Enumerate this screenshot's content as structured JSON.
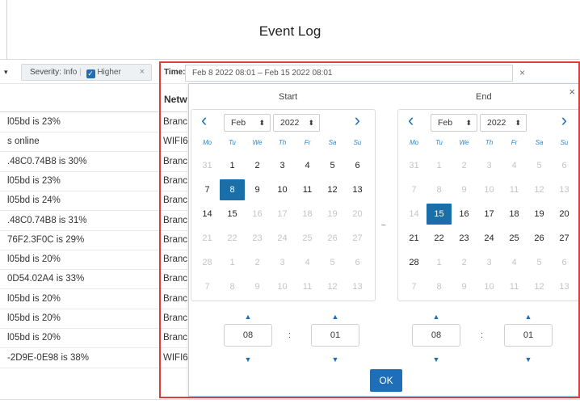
{
  "window": {
    "title": "Event Log"
  },
  "filters": {
    "severity": {
      "label": "Severity:",
      "value": "Info",
      "higher_label": "Higher",
      "close": "×"
    }
  },
  "table": {
    "network_header": "Netw",
    "rows": [
      {
        "desc": "l05bd is 23%",
        "net": "Branc"
      },
      {
        "desc": "s online",
        "net": "WIFI6"
      },
      {
        "desc": ".48C0.74B8 is 30%",
        "net": "Branc"
      },
      {
        "desc": "l05bd is 23%",
        "net": "Branc"
      },
      {
        "desc": "l05bd is 24%",
        "net": "Branc"
      },
      {
        "desc": ".48C0.74B8 is 31%",
        "net": "Branc"
      },
      {
        "desc": "76F2.3F0C is 29%",
        "net": "Branc"
      },
      {
        "desc": "l05bd is 20%",
        "net": "Branc"
      },
      {
        "desc": "0D54.02A4 is 33%",
        "net": "Branc"
      },
      {
        "desc": "l05bd is 20%",
        "net": "Branc"
      },
      {
        "desc": "l05bd is 20%",
        "net": "Branc"
      },
      {
        "desc": "l05bd is 20%",
        "net": "Branc"
      },
      {
        "desc": "-2D9E-0E98 is 38%",
        "net": "WIFI6"
      }
    ]
  },
  "time_filter": {
    "label": "Time:",
    "value": "Feb 8 2022 08:01 – Feb 15 2022 08:01",
    "close": "×"
  },
  "picker": {
    "close": "×",
    "range_separator": "~",
    "ok_label": "OK",
    "weekdays": [
      "Mo",
      "Tu",
      "We",
      "Th",
      "Fr",
      "Sa",
      "Su"
    ],
    "start": {
      "title": "Start",
      "month": "Feb",
      "year": "2022",
      "hour": "08",
      "minute": "01",
      "selected_day": "8",
      "weeks": [
        [
          "31",
          "1",
          "2",
          "3",
          "4",
          "5",
          "6"
        ],
        [
          "7",
          "8",
          "9",
          "10",
          "11",
          "12",
          "13"
        ],
        [
          "14",
          "15",
          "16",
          "17",
          "18",
          "19",
          "20"
        ],
        [
          "21",
          "22",
          "23",
          "24",
          "25",
          "26",
          "27"
        ],
        [
          "28",
          "1",
          "2",
          "3",
          "4",
          "5",
          "6"
        ],
        [
          "7",
          "8",
          "9",
          "10",
          "11",
          "12",
          "13"
        ]
      ],
      "muted": [
        [
          true,
          false,
          false,
          false,
          false,
          false,
          false
        ],
        [
          false,
          false,
          false,
          false,
          false,
          false,
          false
        ],
        [
          false,
          false,
          true,
          true,
          true,
          true,
          true
        ],
        [
          true,
          true,
          true,
          true,
          true,
          true,
          true
        ],
        [
          true,
          true,
          true,
          true,
          true,
          true,
          true
        ],
        [
          true,
          true,
          true,
          true,
          true,
          true,
          true
        ]
      ]
    },
    "end": {
      "title": "End",
      "month": "Feb",
      "year": "2022",
      "hour": "08",
      "minute": "01",
      "selected_day": "15",
      "weeks": [
        [
          "31",
          "1",
          "2",
          "3",
          "4",
          "5",
          "6"
        ],
        [
          "7",
          "8",
          "9",
          "10",
          "11",
          "12",
          "13"
        ],
        [
          "14",
          "15",
          "16",
          "17",
          "18",
          "19",
          "20"
        ],
        [
          "21",
          "22",
          "23",
          "24",
          "25",
          "26",
          "27"
        ],
        [
          "28",
          "1",
          "2",
          "3",
          "4",
          "5",
          "6"
        ],
        [
          "7",
          "8",
          "9",
          "10",
          "11",
          "12",
          "13"
        ]
      ],
      "muted": [
        [
          true,
          true,
          true,
          true,
          true,
          true,
          true
        ],
        [
          true,
          true,
          true,
          true,
          true,
          true,
          true
        ],
        [
          true,
          false,
          false,
          false,
          false,
          false,
          false
        ],
        [
          false,
          false,
          false,
          false,
          false,
          false,
          false
        ],
        [
          false,
          true,
          true,
          true,
          true,
          true,
          true
        ],
        [
          true,
          true,
          true,
          true,
          true,
          true,
          true
        ]
      ]
    }
  }
}
